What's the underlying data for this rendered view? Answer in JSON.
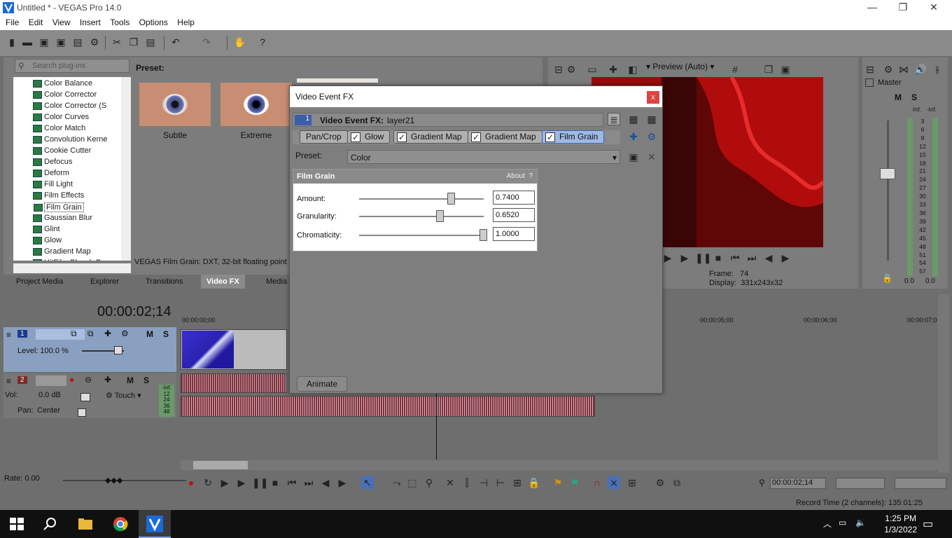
{
  "window": {
    "title": "Untitled * - VEGAS Pro 14.0",
    "minimize": "—",
    "maximize": "❐",
    "close": "✕"
  },
  "menu": [
    "File",
    "Edit",
    "View",
    "Insert",
    "Tools",
    "Options",
    "Help"
  ],
  "plugins": {
    "search_placeholder": "Search plug-ins",
    "items": [
      "Color Balance",
      "Color Corrector",
      "Color Corrector (S",
      "Color Curves",
      "Color Match",
      "Convolution Kerne",
      "Cookie Cutter",
      "Defocus",
      "Deform",
      "Fill Light",
      "Film Effects",
      "Film Grain",
      "Gaussian Blur",
      "Glint",
      "Glow",
      "Gradient Map",
      "HitFilm Bleach Bypa"
    ],
    "selected": "Film Grain",
    "preset_label": "Preset:",
    "presets": [
      "Subtle",
      "Extreme"
    ],
    "status": "VEGAS Film Grain: DXT, 32-bit floating point"
  },
  "tabs": [
    "Project Media",
    "Explorer",
    "Transitions",
    "Video FX",
    "Media G"
  ],
  "active_tab": "Video FX",
  "preview": {
    "mode": "Preview (Auto)",
    "frame_label": "Frame:",
    "frame_value": "74",
    "display_label": "Display:",
    "display_value": "331x243x32"
  },
  "master": {
    "title": "Master",
    "inf1": "-Inf.",
    "inf2": "-Inf.",
    "scale": [
      "3",
      "6",
      "9",
      "12",
      "15",
      "18",
      "21",
      "24",
      "27",
      "30",
      "33",
      "36",
      "39",
      "42",
      "45",
      "48",
      "51",
      "54",
      "57"
    ],
    "val1": "0.0",
    "val2": "0.0"
  },
  "timeline": {
    "timecode": "00:00:02;14",
    "ruler": [
      "00:00:00;00",
      "00:00:05;00",
      "00:00:06;00",
      "00:00:07;0"
    ],
    "track1": {
      "num": "1",
      "level": "Level: 100.0 %",
      "m": "M",
      "s": "S"
    },
    "track2": {
      "num": "2",
      "vol_label": "Vol:",
      "vol_value": "0.0 dB",
      "pan_label": "Pan:",
      "pan_value": "Center",
      "touch": "Touch",
      "m": "M",
      "s": "S",
      "meter": [
        "-Inf.",
        "12",
        "24",
        "36",
        "48"
      ]
    },
    "rate": "Rate: 0.00",
    "cursor_tc": "00:00:02;14",
    "record_time": "Record Time (2 channels): 135:01:25"
  },
  "dialog": {
    "title": "Video Event FX",
    "close": "x",
    "chain_num": "1",
    "chain_title": "Video Event FX:",
    "chain_name": "layer21",
    "chain": [
      {
        "label": "Pan/Crop",
        "check": false
      },
      {
        "label": "Glow",
        "check": true
      },
      {
        "label": "Gradient Map",
        "check": true
      },
      {
        "label": "Gradient Map",
        "check": true
      },
      {
        "label": "Film Grain",
        "check": true,
        "active": true
      }
    ],
    "preset_label": "Preset:",
    "preset_value": "Color",
    "fx_title": "Film Grain",
    "about": "About",
    "about_q": "?",
    "params": [
      {
        "label": "Amount:",
        "value": "0.7400",
        "level": 0.74
      },
      {
        "label": "Granularity:",
        "value": "0.6520",
        "level": 0.652
      },
      {
        "label": "Chromaticity:",
        "value": "1.0000",
        "level": 1.0
      }
    ],
    "animate": "Animate"
  },
  "taskbar": {
    "time": "1:25 PM",
    "date": "1/3/2022"
  }
}
